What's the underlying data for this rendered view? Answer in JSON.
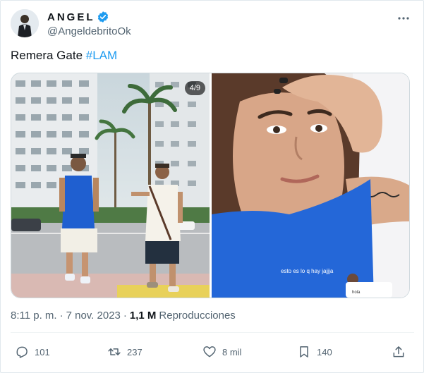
{
  "author": {
    "display_name": "ANGEL",
    "handle": "@AngeldebritoOk"
  },
  "tweet": {
    "text": "Remera Gate ",
    "hashtag": "#LAM"
  },
  "media": {
    "counter": "4/9",
    "caption_main": "esto es lo q hay jajjja",
    "caption_bubble": "hola"
  },
  "meta": {
    "time": "8:11 p. m.",
    "sep1": "·",
    "date": "7 nov. 2023",
    "sep2": "·",
    "views_count": "1,1 M",
    "views_label": "Reproducciones"
  },
  "actions": {
    "replies": "101",
    "retweets": "237",
    "likes": "8 mil",
    "bookmarks": "140"
  },
  "colors": {
    "accent": "#1d9bf0",
    "text": "#0f1419",
    "muted": "#536471"
  }
}
